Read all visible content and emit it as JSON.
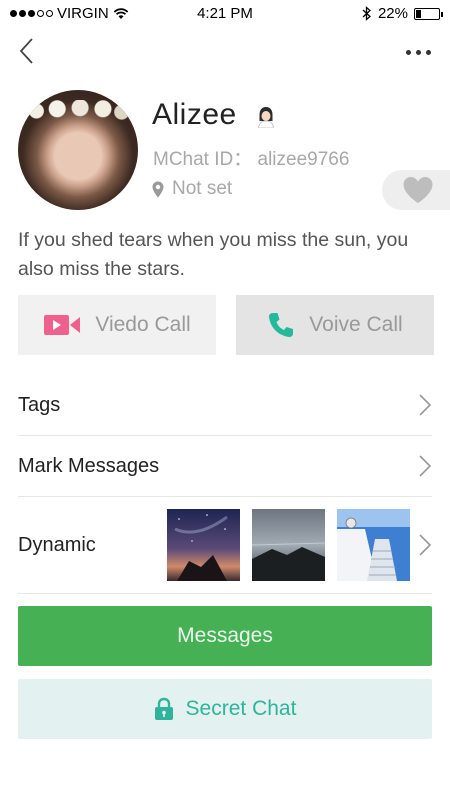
{
  "status_bar": {
    "carrier": "VIRGIN",
    "time": "4:21 PM",
    "battery": "22%",
    "battery_level": 0.22,
    "signal_bars_filled": 3,
    "signal_bars_total": 5
  },
  "nav": {
    "back_icon": "chevron-left-icon",
    "more_icon": "more-dots-icon"
  },
  "profile": {
    "name": "Alizee",
    "gender_icon": "female-avatar-icon",
    "mchat_id": "MChat ID： alizee9766",
    "location": "Not set",
    "location_icon": "location-pin-icon",
    "favorite_icon": "heart-icon",
    "bio": "If you shed tears when you miss the sun, you also miss the stars."
  },
  "calls": {
    "video_label": "Viedo Call",
    "voice_label": "Voive Call",
    "video_icon_color": "#f0608e",
    "voice_icon_color": "#24b99a"
  },
  "rows": {
    "tags": "Tags",
    "mark_messages": "Mark Messages",
    "dynamic": "Dynamic"
  },
  "dynamic_thumbs": [
    "starry-night-coast",
    "stormy-rocky-sea",
    "seaside-stairs"
  ],
  "buttons": {
    "messages": "Messages",
    "secret_chat": "Secret Chat"
  },
  "colors": {
    "primary_green": "#45b154",
    "secret_teal": "#2fb39a",
    "secret_bg": "#e3f2f1"
  }
}
